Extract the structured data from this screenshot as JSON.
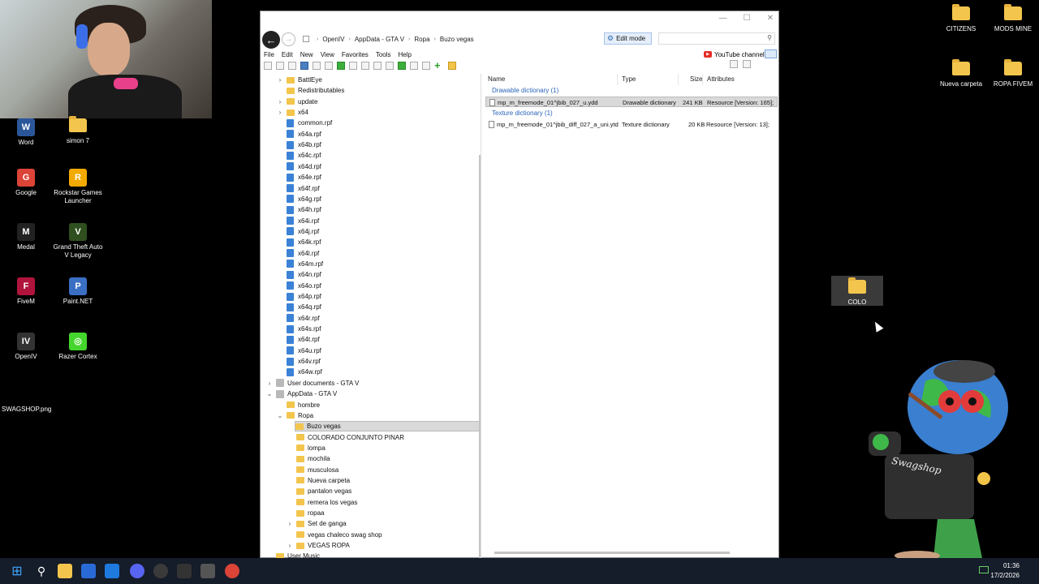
{
  "desktop": {
    "left_icons": [
      {
        "label": "Word",
        "icon": "word-icon",
        "color": "#2b579a",
        "glyph": "W"
      },
      {
        "label": "simon 7",
        "icon": "folder-icon",
        "color": "#f3c54d",
        "glyph": ""
      },
      {
        "label": "Google",
        "icon": "chrome-icon",
        "color": "#db4437",
        "glyph": "G"
      },
      {
        "label": "Rockstar Games Launcher",
        "icon": "rockstar-icon",
        "color": "#f2a900",
        "glyph": "R"
      },
      {
        "label": "Medal",
        "icon": "medal-icon",
        "color": "#222222",
        "glyph": "M"
      },
      {
        "label": "Grand Theft Auto V Legacy",
        "icon": "gta-icon",
        "color": "#2f4f1f",
        "glyph": "V"
      },
      {
        "label": "FiveM",
        "icon": "fivem-icon",
        "color": "#b0143c",
        "glyph": "F"
      },
      {
        "label": "Paint.NET",
        "icon": "paintnet-icon",
        "color": "#3b6fc4",
        "glyph": "P"
      },
      {
        "label": "OpenIV",
        "icon": "openiv-icon",
        "color": "#333333",
        "glyph": "IV"
      },
      {
        "label": "Razer Cortex",
        "icon": "razer-icon",
        "color": "#44d62c",
        "glyph": "◎"
      }
    ],
    "right_icons": [
      {
        "label": "CITIZENS"
      },
      {
        "label": "MODS MINE"
      },
      {
        "label": "Nueva carpeta"
      },
      {
        "label": "ROPA FIVEM"
      }
    ],
    "colo_label": "COLO",
    "swagshop_label": "SWAGSHOP.png",
    "mascot_text": "Swagshop"
  },
  "window": {
    "breadcrumbs": [
      "OpenIV",
      "AppData - GTA V",
      "Ropa",
      "Buzo vegas"
    ],
    "edit_mode": "Edit mode",
    "youtube": "YouTube channel",
    "menu": [
      "File",
      "Edit",
      "New",
      "View",
      "Favorites",
      "Tools",
      "Help"
    ],
    "tree": [
      {
        "label": "BattlEye",
        "type": "folder",
        "indent": 1,
        "chevron": "›"
      },
      {
        "label": "Redistributables",
        "type": "folder",
        "indent": 1,
        "chevron": ""
      },
      {
        "label": "update",
        "type": "folder",
        "indent": 1,
        "chevron": "›"
      },
      {
        "label": "x64",
        "type": "folder",
        "indent": 1,
        "chevron": "›"
      },
      {
        "label": "common.rpf",
        "type": "rpf",
        "indent": 1,
        "chevron": ""
      },
      {
        "label": "x64a.rpf",
        "type": "rpf",
        "indent": 1,
        "chevron": ""
      },
      {
        "label": "x64b.rpf",
        "type": "rpf",
        "indent": 1,
        "chevron": ""
      },
      {
        "label": "x64c.rpf",
        "type": "rpf",
        "indent": 1,
        "chevron": ""
      },
      {
        "label": "x64d.rpf",
        "type": "rpf",
        "indent": 1,
        "chevron": ""
      },
      {
        "label": "x64e.rpf",
        "type": "rpf",
        "indent": 1,
        "chevron": ""
      },
      {
        "label": "x64f.rpf",
        "type": "rpf",
        "indent": 1,
        "chevron": ""
      },
      {
        "label": "x64g.rpf",
        "type": "rpf",
        "indent": 1,
        "chevron": ""
      },
      {
        "label": "x64h.rpf",
        "type": "rpf",
        "indent": 1,
        "chevron": ""
      },
      {
        "label": "x64i.rpf",
        "type": "rpf",
        "indent": 1,
        "chevron": ""
      },
      {
        "label": "x64j.rpf",
        "type": "rpf",
        "indent": 1,
        "chevron": ""
      },
      {
        "label": "x64k.rpf",
        "type": "rpf",
        "indent": 1,
        "chevron": ""
      },
      {
        "label": "x64l.rpf",
        "type": "rpf",
        "indent": 1,
        "chevron": ""
      },
      {
        "label": "x64m.rpf",
        "type": "rpf",
        "indent": 1,
        "chevron": ""
      },
      {
        "label": "x64n.rpf",
        "type": "rpf",
        "indent": 1,
        "chevron": ""
      },
      {
        "label": "x64o.rpf",
        "type": "rpf",
        "indent": 1,
        "chevron": ""
      },
      {
        "label": "x64p.rpf",
        "type": "rpf",
        "indent": 1,
        "chevron": ""
      },
      {
        "label": "x64q.rpf",
        "type": "rpf",
        "indent": 1,
        "chevron": ""
      },
      {
        "label": "x64r.rpf",
        "type": "rpf",
        "indent": 1,
        "chevron": ""
      },
      {
        "label": "x64s.rpf",
        "type": "rpf",
        "indent": 1,
        "chevron": ""
      },
      {
        "label": "x64t.rpf",
        "type": "rpf",
        "indent": 1,
        "chevron": ""
      },
      {
        "label": "x64u.rpf",
        "type": "rpf",
        "indent": 1,
        "chevron": ""
      },
      {
        "label": "x64v.rpf",
        "type": "rpf",
        "indent": 1,
        "chevron": ""
      },
      {
        "label": "x64w.rpf",
        "type": "rpf",
        "indent": 1,
        "chevron": ""
      },
      {
        "label": "User documents - GTA V",
        "type": "doc",
        "indent": 0,
        "chevron": "›"
      },
      {
        "label": "AppData - GTA V",
        "type": "doc",
        "indent": 0,
        "chevron": "⌄"
      },
      {
        "label": "hombre",
        "type": "folder",
        "indent": 1,
        "chevron": ""
      },
      {
        "label": "Ropa",
        "type": "folder",
        "indent": 1,
        "chevron": "⌄"
      },
      {
        "label": "Buzo vegas",
        "type": "folder",
        "indent": 2,
        "chevron": "",
        "selected": true
      },
      {
        "label": "COLORADO CONJUNTO PINAR",
        "type": "folder",
        "indent": 2,
        "chevron": ""
      },
      {
        "label": "lompa",
        "type": "folder",
        "indent": 2,
        "chevron": ""
      },
      {
        "label": "mochila",
        "type": "folder",
        "indent": 2,
        "chevron": ""
      },
      {
        "label": "musculosa",
        "type": "folder",
        "indent": 2,
        "chevron": ""
      },
      {
        "label": "Nueva carpeta",
        "type": "folder",
        "indent": 2,
        "chevron": ""
      },
      {
        "label": "pantalon vegas",
        "type": "folder",
        "indent": 2,
        "chevron": ""
      },
      {
        "label": "remera los vegas",
        "type": "folder",
        "indent": 2,
        "chevron": ""
      },
      {
        "label": "ropaa",
        "type": "folder",
        "indent": 2,
        "chevron": ""
      },
      {
        "label": "Set de ganga",
        "type": "folder",
        "indent": 2,
        "chevron": "›"
      },
      {
        "label": "vegas chaleco swag shop",
        "type": "folder",
        "indent": 2,
        "chevron": ""
      },
      {
        "label": "VEGAS ROPA",
        "type": "folder",
        "indent": 2,
        "chevron": "›"
      },
      {
        "label": "User Music",
        "type": "folder",
        "indent": 0,
        "chevron": ""
      }
    ],
    "columns": [
      "Name",
      "Type",
      "Size",
      "Attributes"
    ],
    "groups": [
      {
        "title": "Drawable dictionary (1)",
        "files": [
          {
            "name": "mp_m_freemode_01^jbib_027_u.ydd",
            "type": "Drawable dictionary",
            "size": "241 KB",
            "attributes": "Resource [Version: 165];",
            "selected": true
          }
        ]
      },
      {
        "title": "Texture dictionary (1)",
        "files": [
          {
            "name": "mp_m_freemode_01^jbib_diff_027_a_uni.ytd",
            "type": "Texture dictionary",
            "size": "20 KB",
            "attributes": "Resource [Version: 13];",
            "selected": false
          }
        ]
      }
    ]
  },
  "taskbar": {
    "time": "01:36",
    "date": "17/2/2026"
  }
}
